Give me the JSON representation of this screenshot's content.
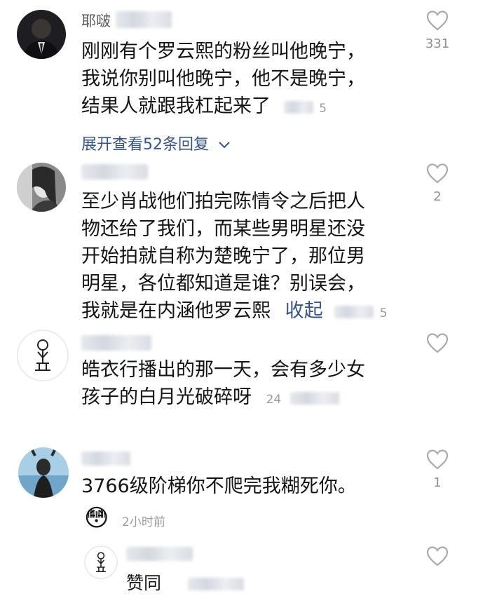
{
  "comments": [
    {
      "name": "耶啵",
      "lines": [
        "刚刚有个罗云熙的粉丝叫他晚宁，",
        "我说你别叫他晚宁，他不是晚宁，",
        "结果人就跟我杠起来了"
      ],
      "meta_tail": "5",
      "likes": "331",
      "expand_label": "展开查看52条回复"
    },
    {
      "name": "",
      "lines": [
        "至少肖战他们拍完陈情令之后把人",
        "物还给了我们，而某些男明星还没",
        "开始拍就自称为楚晚宁了，那位男",
        "明星，各位都知道是谁？别误会，",
        "我就是在内涵他罗云熙"
      ],
      "collapse_label": "收起",
      "meta_tail": "5",
      "likes": "2"
    },
    {
      "name": "",
      "lines": [
        "皓衣行播出的那一天，会有多少女",
        "孩子的白月光破碎呀"
      ],
      "meta_tail": "24",
      "likes": ""
    },
    {
      "name": "",
      "lines": [
        "3766级阶梯你不爬完我糊死你。"
      ],
      "emoji": "😳",
      "meta": "2小时前",
      "likes": "1"
    },
    {
      "name": "",
      "lines": [
        "赞同"
      ],
      "likes": ""
    }
  ]
}
